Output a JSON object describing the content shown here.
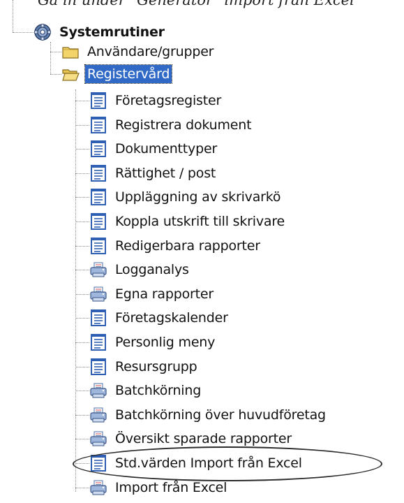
{
  "top_cutoff_text": "Ga in under \"Generator\" import från Excel",
  "root": {
    "label": "Systemrutiner",
    "icon": "gear-icon"
  },
  "folders": [
    {
      "label": "Användare/grupper",
      "icon": "folder-closed-icon",
      "selected": false
    },
    {
      "label": "Registervård",
      "icon": "folder-open-icon",
      "selected": true
    }
  ],
  "items": [
    {
      "label": "Företagsregister",
      "icon": "document-icon"
    },
    {
      "label": "Registrera dokument",
      "icon": "document-icon"
    },
    {
      "label": "Dokumenttyper",
      "icon": "document-icon"
    },
    {
      "label": "Rättighet / post",
      "icon": "document-icon"
    },
    {
      "label": "Uppläggning av skrivarkö",
      "icon": "document-icon"
    },
    {
      "label": "Koppla utskrift till skrivare",
      "icon": "document-icon"
    },
    {
      "label": "Redigerbara rapporter",
      "icon": "document-icon"
    },
    {
      "label": "Logganalys",
      "icon": "printer-icon"
    },
    {
      "label": "Egna rapporter",
      "icon": "printer-icon"
    },
    {
      "label": "Företagskalender",
      "icon": "document-icon"
    },
    {
      "label": "Personlig meny",
      "icon": "document-icon"
    },
    {
      "label": "Resursgrupp",
      "icon": "document-icon"
    },
    {
      "label": "Batchkörning",
      "icon": "printer-icon"
    },
    {
      "label": "Batchkörning över huvudföretag",
      "icon": "printer-icon"
    },
    {
      "label": "Översikt sparade rapporter",
      "icon": "printer-icon"
    },
    {
      "label": "Std.värden Import från Excel",
      "icon": "document-icon",
      "highlighted": true
    },
    {
      "label": "Import från Excel",
      "icon": "printer-icon"
    }
  ],
  "colors": {
    "selection_bg": "#3169c6",
    "selection_text": "#ffffff",
    "folder_yellow": "#f2d46a",
    "document_blue": "#2f5fb3"
  }
}
